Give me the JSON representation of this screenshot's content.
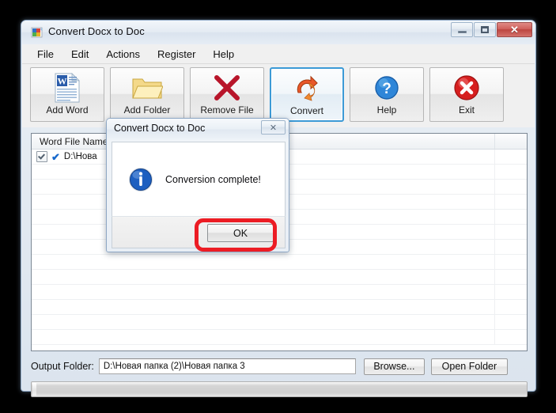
{
  "window": {
    "title": "Convert Docx to Doc",
    "icon": "app-icon",
    "controls": {
      "minimize": "minimize",
      "maximize": "maximize",
      "close": "✕"
    }
  },
  "menu": {
    "items": [
      {
        "label": "File"
      },
      {
        "label": "Edit"
      },
      {
        "label": "Actions"
      },
      {
        "label": "Register"
      },
      {
        "label": "Help"
      }
    ]
  },
  "toolbar": {
    "buttons": [
      {
        "label": "Add Word",
        "icon": "word-document-icon",
        "active": false
      },
      {
        "label": "Add Folder",
        "icon": "folder-icon",
        "active": false
      },
      {
        "label": "Remove File",
        "icon": "red-x-icon",
        "active": false
      },
      {
        "label": "Convert",
        "icon": "refresh-arrows-icon",
        "active": true
      },
      {
        "label": "Help",
        "icon": "question-mark-icon",
        "active": false
      },
      {
        "label": "Exit",
        "icon": "exit-x-circle-icon",
        "active": false
      }
    ]
  },
  "filelist": {
    "columns": [
      "Word File Name",
      ""
    ],
    "rows": [
      {
        "checked": true,
        "status": "✔",
        "name": "D:\\Нова"
      }
    ],
    "empty_row_count": 11
  },
  "output": {
    "label": "Output Folder:",
    "path": "D:\\Новая папка (2)\\Новая папка 3",
    "browse_label": "Browse...",
    "open_folder_label": "Open Folder"
  },
  "progress": {
    "value": 0
  },
  "dialog": {
    "title": "Convert Docx to Doc",
    "close_glyph": "✕",
    "message": "Conversion complete!",
    "icon": "info-icon",
    "ok_label": "OK",
    "highlighted": true
  },
  "colors": {
    "accent_blue": "#3c9ad6",
    "annotation_red": "#ec1c24",
    "close_red": "#bc4540",
    "check_blue": "#1668cc"
  }
}
